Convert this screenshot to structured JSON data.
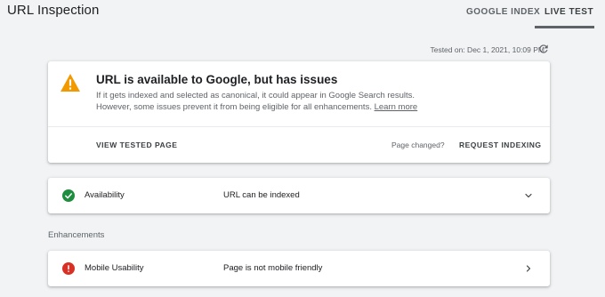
{
  "header": {
    "title": "URL Inspection",
    "tabs": [
      {
        "label": "GOOGLE INDEX",
        "active": false
      },
      {
        "label": "LIVE TEST",
        "active": true
      }
    ]
  },
  "tested_on": "Tested on: Dec 1, 2021, 10:09 PM",
  "summary": {
    "icon": "warning-icon",
    "title": "URL is available to Google, but has issues",
    "desc_line1": "If it gets indexed and selected as canonical, it could appear in Google Search results.",
    "desc_line2": "However, some issues prevent it from being eligible for all enhancements.",
    "learn_more": "Learn more",
    "view_tested_page": "VIEW TESTED PAGE",
    "page_changed": "Page changed?",
    "request_indexing": "REQUEST INDEXING"
  },
  "availability": {
    "icon": "check-circle-icon",
    "label": "Availability",
    "status": "URL can be indexed"
  },
  "enhancements": {
    "heading": "Enhancements",
    "items": [
      {
        "icon": "error-circle-icon",
        "label": "Mobile Usability",
        "status": "Page is not mobile friendly"
      }
    ]
  },
  "colors": {
    "background": "#f1f3f4",
    "warning": "#f29900",
    "success": "#1e8e3e",
    "error": "#d93025",
    "text_primary": "#202124",
    "text_secondary": "#5f6368"
  }
}
